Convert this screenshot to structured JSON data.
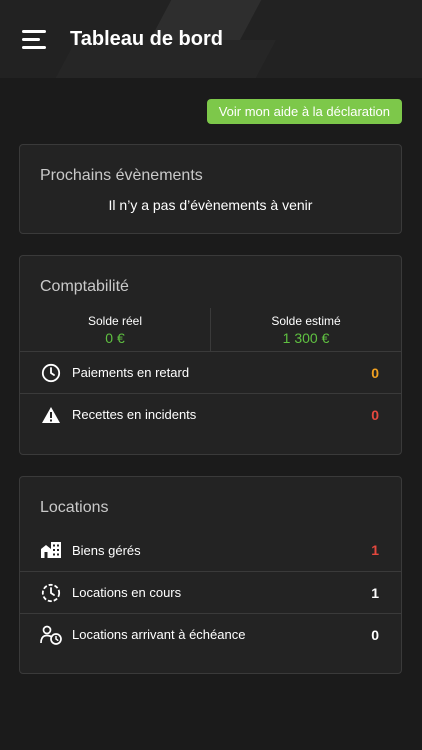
{
  "header": {
    "title": "Tableau de bord",
    "menu_icon": "hamburger-menu-icon"
  },
  "declaration_button": {
    "label": "Voir mon aide à la déclaration",
    "color": "#7dc84a"
  },
  "events": {
    "title": "Prochains évènements",
    "empty_text": "Il n’y a pas d’évènements à venir"
  },
  "accounting": {
    "title": "Comptabilité",
    "balances": [
      {
        "label": "Solde réel",
        "value": "0 €"
      },
      {
        "label": "Solde estimé",
        "value": "1 300 €"
      }
    ],
    "rows": [
      {
        "icon": "clock-icon",
        "label": "Paiements en retard",
        "count": "0",
        "color": "#f0a020"
      },
      {
        "icon": "warning-icon",
        "label": "Recettes en incidents",
        "count": "0",
        "color": "#e5483e"
      }
    ]
  },
  "rentals": {
    "title": "Locations",
    "rows": [
      {
        "icon": "buildings-icon",
        "label": "Biens gérés",
        "count": "1",
        "color": "#e5483e"
      },
      {
        "icon": "clock-dashed-icon",
        "label": "Locations en cours",
        "count": "1",
        "color": "#ffffff"
      },
      {
        "icon": "person-clock-icon",
        "label": "Locations arrivant à échéance",
        "count": "0",
        "color": "#ffffff"
      }
    ]
  },
  "colors": {
    "background": "#1b1b1b",
    "card": "#232323",
    "accent_green": "#5fc041",
    "orange": "#f0a020",
    "red": "#e5483e"
  }
}
